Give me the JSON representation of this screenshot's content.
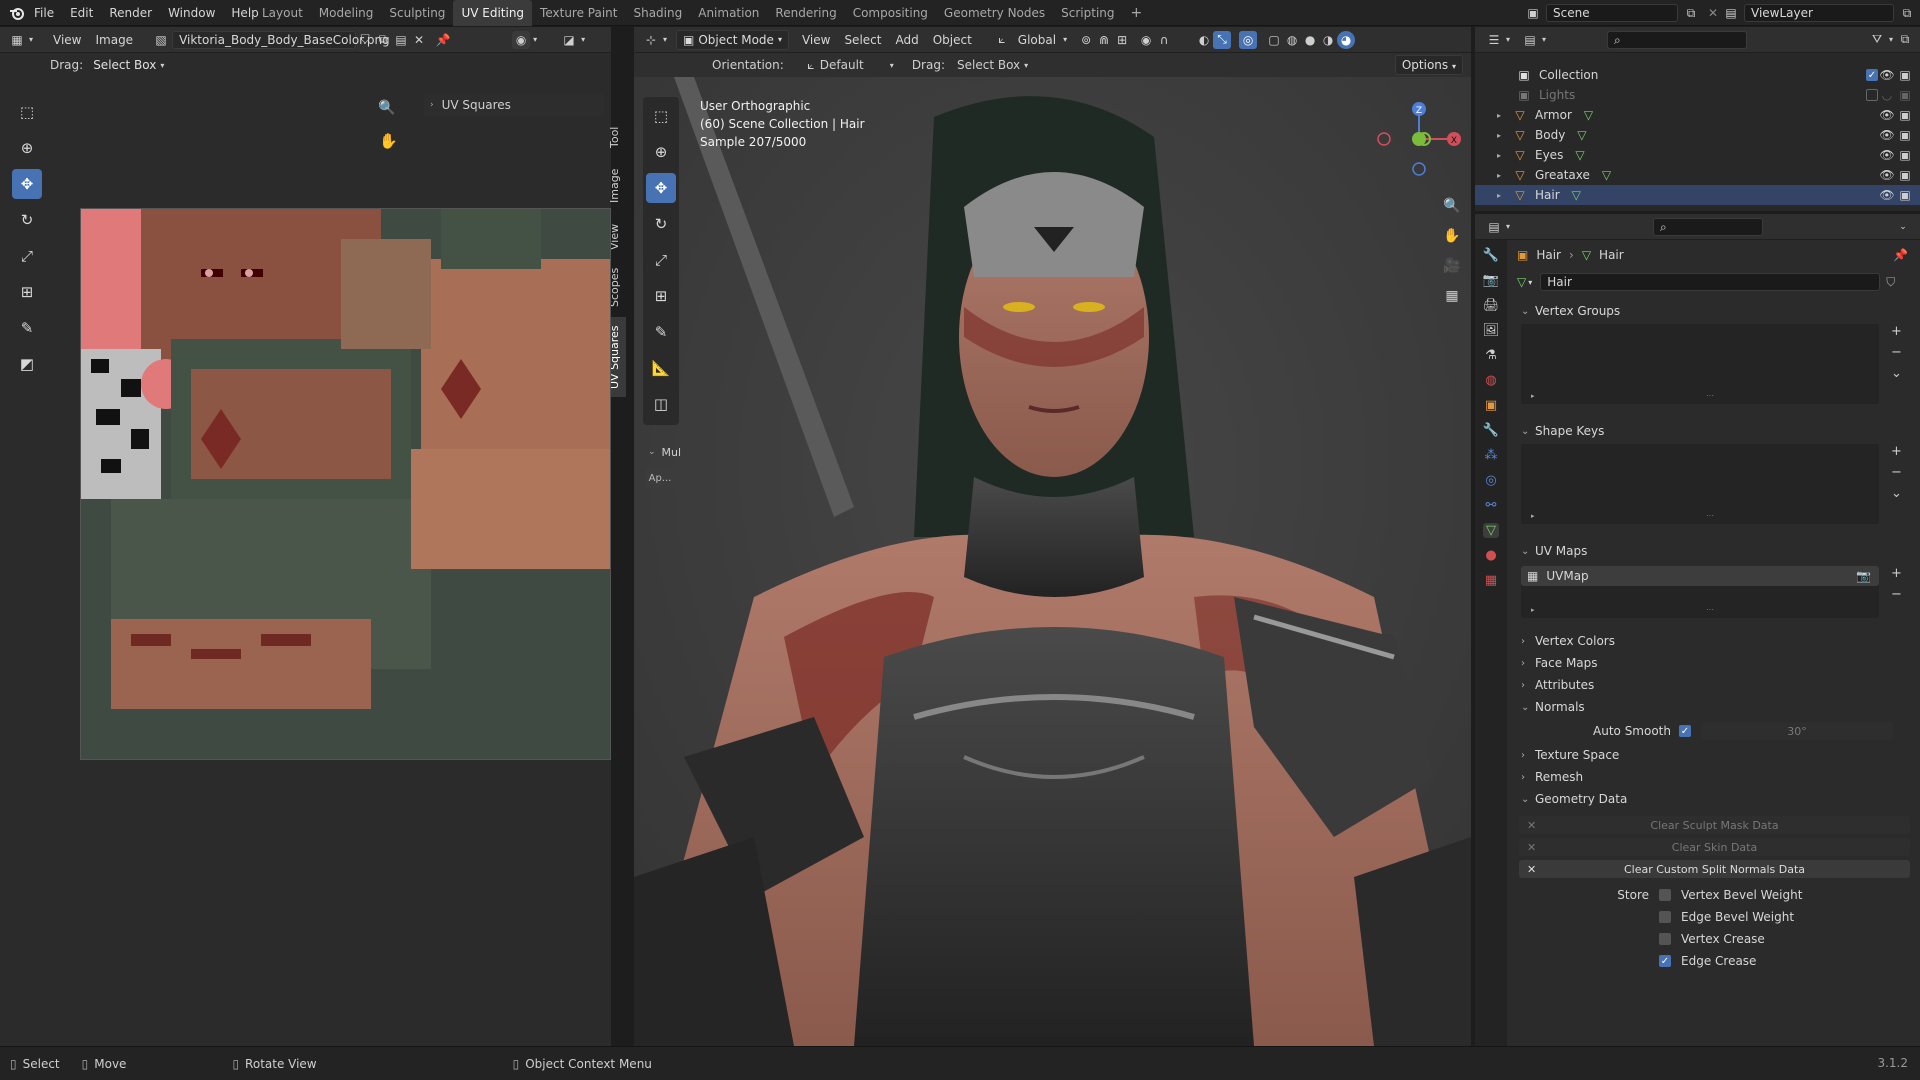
{
  "menu": [
    "File",
    "Edit",
    "Render",
    "Window",
    "Help"
  ],
  "workspaces": [
    "Layout",
    "Modeling",
    "Sculpting",
    "UV Editing",
    "Texture Paint",
    "Shading",
    "Animation",
    "Rendering",
    "Compositing",
    "Geometry Nodes",
    "Scripting"
  ],
  "active_workspace": "UV Editing",
  "scene": "Scene",
  "view_layer": "ViewLayer",
  "uv_editor": {
    "menus": [
      "View",
      "Image"
    ],
    "image_name": "Viktoria_Body_Body_BaseColor.png",
    "drag_label": "Drag:",
    "drag_value": "Select Box",
    "panel_title": "UV Squares",
    "side_tabs": [
      "Tool",
      "Image",
      "View",
      "Scopes",
      "UV Squares"
    ]
  },
  "viewport": {
    "mode": "Object Mode",
    "menus": [
      "View",
      "Select",
      "Add",
      "Object"
    ],
    "orientation_global": "Global",
    "orientation_label": "Orientation:",
    "orientation_value": "Default",
    "drag_label": "Drag:",
    "drag_value": "Select Box",
    "options": "Options",
    "overlay_line1": "User Orthographic",
    "overlay_line2": "(60) Scene Collection | Hair",
    "overlay_line3": "Sample 207/5000",
    "mul_label": "Mul",
    "ap_label": "Ap...",
    "gizmo_axes": {
      "z": "Z",
      "x": "X"
    }
  },
  "outliner": {
    "collection": "Collection",
    "items": [
      {
        "name": "Lights",
        "dim": true
      },
      {
        "name": "Armor",
        "dim": false
      },
      {
        "name": "Body",
        "dim": false
      },
      {
        "name": "Eyes",
        "dim": false
      },
      {
        "name": "Greataxe",
        "dim": false
      },
      {
        "name": "Hair",
        "dim": false
      }
    ]
  },
  "properties": {
    "breadcrumb_obj": "Hair",
    "breadcrumb_data": "Hair",
    "data_name": "Hair",
    "panels": {
      "vertex_groups": "Vertex Groups",
      "shape_keys": "Shape Keys",
      "uv_maps": "UV Maps",
      "uvmap_item": "UVMap",
      "vertex_colors": "Vertex Colors",
      "face_maps": "Face Maps",
      "attributes": "Attributes",
      "normals": "Normals",
      "auto_smooth": "Auto Smooth",
      "auto_smooth_angle": "30°",
      "texture_space": "Texture Space",
      "remesh": "Remesh",
      "geometry_data": "Geometry Data",
      "clear_sculpt": "Clear Sculpt Mask Data",
      "clear_skin": "Clear Skin Data",
      "clear_custom": "Clear Custom Split Normals Data",
      "store": "Store",
      "vertex_bevel": "Vertex Bevel Weight",
      "edge_bevel": "Edge Bevel Weight",
      "vertex_crease": "Vertex Crease",
      "edge_crease": "Edge Crease"
    }
  },
  "status": {
    "select": "Select",
    "move": "Move",
    "rotate": "Rotate View",
    "context": "Object Context Menu",
    "version": "3.1.2"
  },
  "colors": {
    "accent": "#4772b3",
    "mesh_icon": "#e09a3d",
    "data_icon": "#7ad36a"
  }
}
